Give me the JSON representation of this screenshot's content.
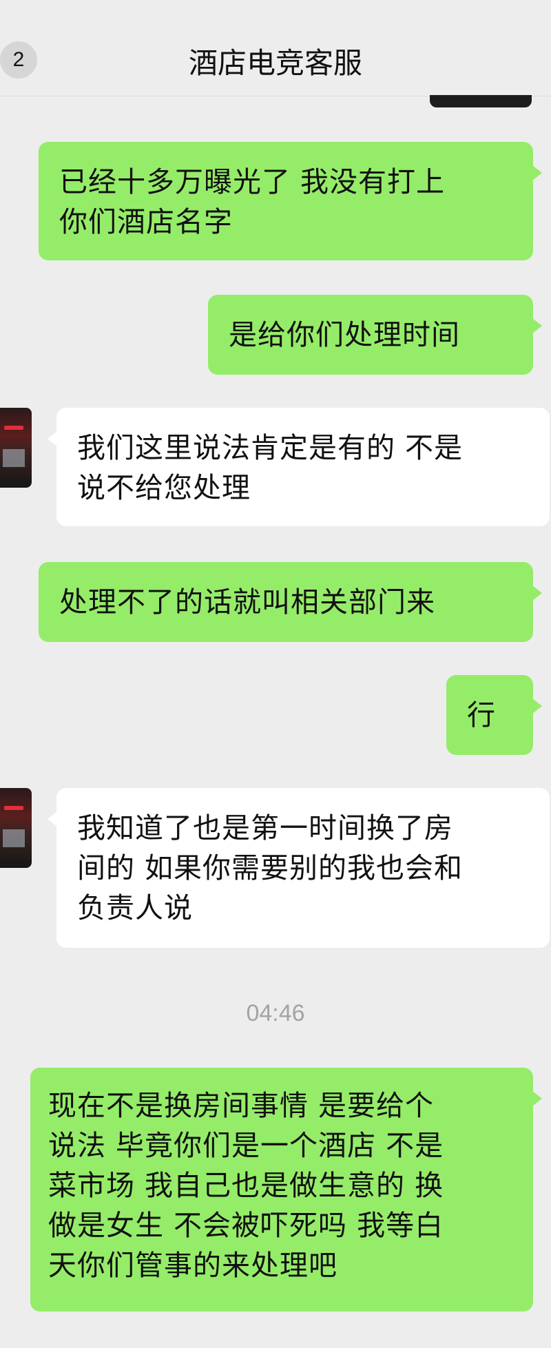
{
  "header": {
    "unread_count": "2",
    "title": "酒店电竞客服"
  },
  "messages": [
    {
      "from": "me",
      "lines": [
        "已经十多万曝光了 我没有打上",
        "你们酒店名字"
      ]
    },
    {
      "from": "me",
      "lines": [
        "是给你们处理时间"
      ]
    },
    {
      "from": "them",
      "lines": [
        "我们这里说法肯定是有的 不是",
        "说不给您处理"
      ]
    },
    {
      "from": "me",
      "lines": [
        "处理不了的话就叫相关部门来"
      ]
    },
    {
      "from": "me",
      "lines": [
        "行"
      ]
    },
    {
      "from": "them",
      "lines": [
        "我知道了也是第一时间换了房",
        "间的 如果你需要别的我也会和",
        "负责人说"
      ]
    },
    {
      "from": "me",
      "lines": [
        "现在不是换房间事情  是要给个",
        "说法 毕竟你们是一个酒店 不是",
        "菜市场 我自己也是做生意的 换",
        "做是女生 不会被吓死吗 我等白",
        "天你们管事的来处理吧"
      ]
    }
  ],
  "timestamp": "04:46",
  "colors": {
    "background": "#ededed",
    "my_bubble": "#95ec69",
    "their_bubble": "#ffffff",
    "timestamp_text": "#a3a3a3"
  }
}
